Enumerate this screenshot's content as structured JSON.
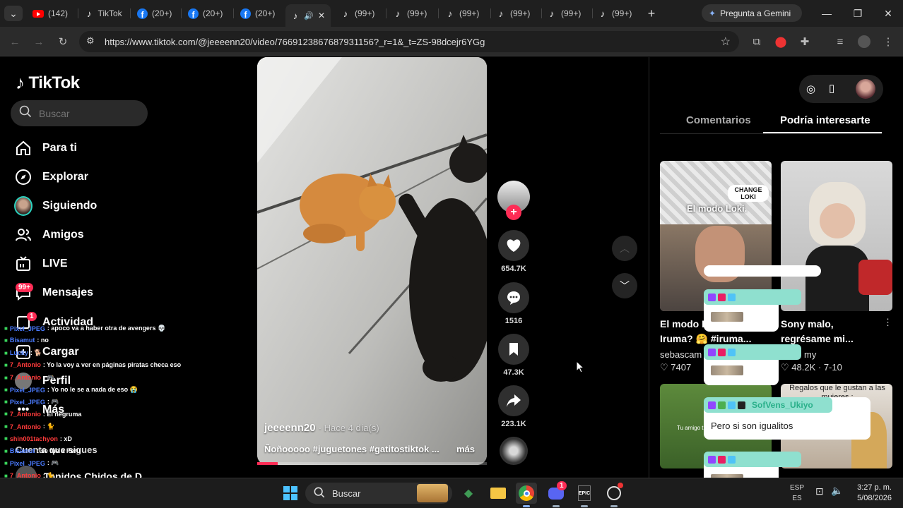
{
  "browser": {
    "tabs": [
      {
        "icon": "youtube-icon",
        "label": "(142)"
      },
      {
        "icon": "tiktok-icon",
        "label": "TikTok"
      },
      {
        "icon": "facebook-icon",
        "label": "(20+)"
      },
      {
        "icon": "facebook-icon",
        "label": "(20+)"
      },
      {
        "icon": "facebook-icon",
        "label": "(20+)"
      },
      {
        "icon": "tiktok-icon",
        "label": ""
      },
      {
        "icon": "tiktok-icon",
        "label": "(99+)"
      },
      {
        "icon": "tiktok-icon",
        "label": "(99+)"
      },
      {
        "icon": "tiktok-icon",
        "label": "(99+)"
      },
      {
        "icon": "tiktok-icon",
        "label": "(99+)"
      },
      {
        "icon": "tiktok-icon",
        "label": "(99+)"
      },
      {
        "icon": "tiktok-icon",
        "label": "(99+)"
      }
    ],
    "gemini_label": "Pregunta a Gemini",
    "url": "https://www.tiktok.com/@jeeeenn20/video/7669123867687931156?_r=1&_t=ZS-98dcejr6YGg"
  },
  "tiktok": {
    "logo_text": "TikTok",
    "search_placeholder": "Buscar",
    "nav": [
      {
        "icon": "home-icon",
        "label": "Para ti"
      },
      {
        "icon": "compass-icon",
        "label": "Explorar"
      },
      {
        "icon": "avatar",
        "label": "Siguiendo"
      },
      {
        "icon": "friends-icon",
        "label": "Amigos"
      },
      {
        "icon": "live-icon",
        "label": "LIVE"
      },
      {
        "icon": "inbox-icon",
        "label": "Mensajes",
        "badge": "99+"
      },
      {
        "icon": "activity-icon",
        "label": "Actividad",
        "badge": "1"
      },
      {
        "icon": "upload-icon",
        "label": "Cargar"
      },
      {
        "icon": "profile-icon",
        "label": "Perfil"
      },
      {
        "icon": "more-icon",
        "label": "Más"
      }
    ],
    "following_heading": "Cuenta que sigues",
    "following_item": "Tonidos Chidos de D...",
    "video": {
      "username": "jeeeenn20",
      "time": "· Hace 4 día(s)",
      "description": "Ñoñooooo #juguetones #gatitostiktok ...",
      "more": "más",
      "progress": 0.09
    },
    "actions": {
      "likes": "654.7K",
      "comments": "1516",
      "saves": "47.3K",
      "shares": "223.1K"
    },
    "right_tabs": {
      "comments": "Comentarios",
      "recommended": "Podría interesarte"
    },
    "cards": [
      {
        "title1": "El modo L",
        "title2": "Iruma? 🤗 #iruma...",
        "author": "sebascam",
        "likes": "7407",
        "thumb_text": "El modo Loki.",
        "thumb_sub": "CHANGE LOKI"
      },
      {
        "title1": "Sony malo,",
        "title2": "regrésame mi...",
        "author": "my",
        "likes": "48.2K",
        "date": "7-10"
      },
      {
        "thumb_text": "Tu amigo t"
      },
      {
        "thumb_text": "Regalos que le gustan a las mujeres :"
      }
    ],
    "like_icon": "heart-icon"
  },
  "chat": [
    {
      "user": "Pixel_JPEG",
      "color": "#4a7bff",
      "msg": ": apoco va a haber otra de avengers 💀"
    },
    {
      "user": "Bisamut",
      "color": "#4a7bff",
      "msg": ": no"
    },
    {
      "user": "Lucky",
      "color": "#4a7bff",
      "msg": ": 🐕"
    },
    {
      "user": "7_Antonio",
      "color": "#ff3b3b",
      "msg": ": Yo la voy a ver en páginas piratas checa eso"
    },
    {
      "user": "7_Antonio",
      "color": "#ff3b3b",
      "msg": ": 🎮"
    },
    {
      "user": "Pixel_JPEG",
      "color": "#4a7bff",
      "msg": ": Yo no le se a nada de eso 😭"
    },
    {
      "user": "Pixel_JPEG",
      "color": "#4a7bff",
      "msg": ": 🎮"
    },
    {
      "user": "7_Antonio",
      "color": "#ff3b3b",
      "msg": ": El negruma"
    },
    {
      "user": "7_Antonio",
      "color": "#ff3b3b",
      "msg": ": 🐈"
    },
    {
      "user": "shin001tachyon",
      "color": "#ff3b3b",
      "msg": ": xD"
    },
    {
      "user": "Bisamut",
      "color": "#4a7bff",
      "msg": ": se fue a Peru"
    },
    {
      "user": "Pixel_JPEG",
      "color": "#4a7bff",
      "msg": ": 🎮"
    },
    {
      "user": "7_Antonio",
      "color": "#ff3b3b",
      "msg": ": 🐈"
    },
    {
      "user": "7_Antonio",
      "color": "#ff3b3b",
      "msg": ": El señor de la tienda"
    },
    {
      "user": "7_Antonio",
      "color": "#ff3b3b",
      "msg": ": 🐈"
    }
  ],
  "popups": [
    {
      "name": "SofVens_Ukiyo",
      "text": "Pero si son igualitos"
    }
  ],
  "taskbar": {
    "search": "Buscar",
    "lang1": "ESP",
    "lang2": "ES",
    "time": "3:27 p. m.",
    "date": "5/08/2026",
    "discord_badge": "1"
  },
  "colors": {
    "accent": "#fe2c55",
    "background": "#000000"
  }
}
